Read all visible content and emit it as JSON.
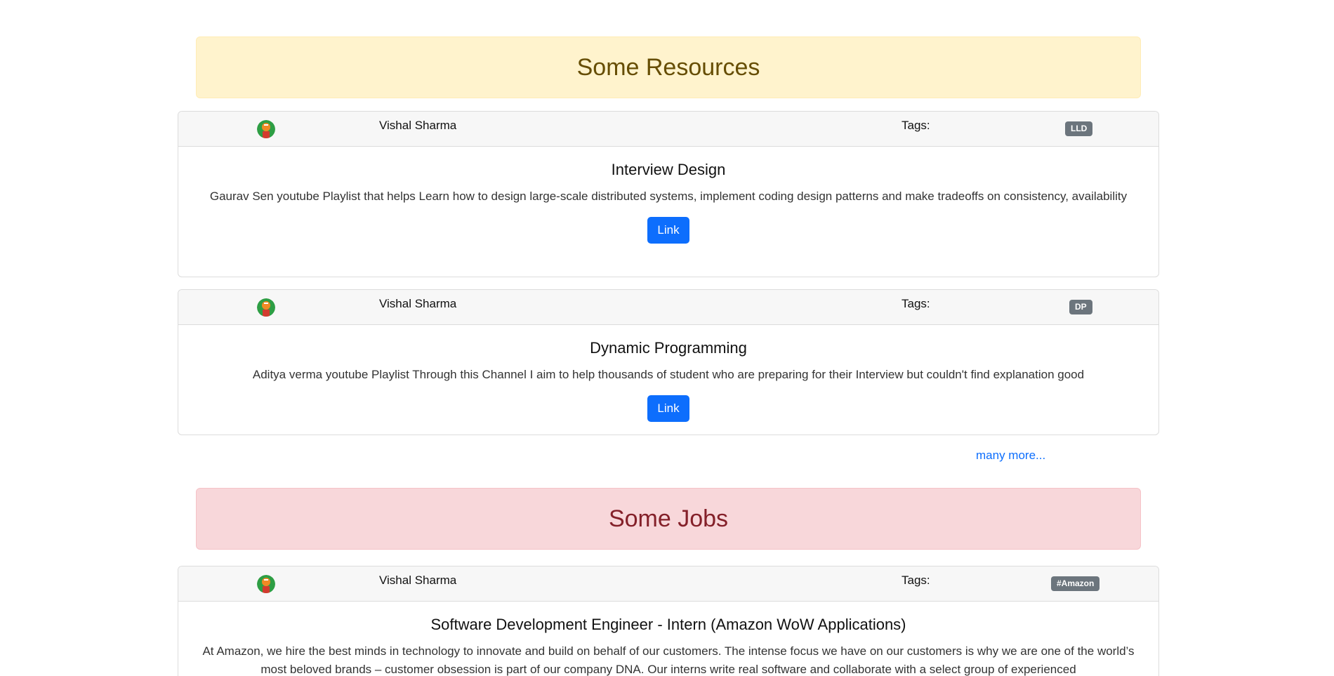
{
  "resources": {
    "heading": "Some Resources",
    "items": [
      {
        "author": "Vishal Sharma",
        "tags_label": "Tags:",
        "tag": "LLD",
        "title": "Interview Design",
        "description": "Gaurav Sen youtube Playlist that helps Learn how to design large-scale distributed systems, implement coding design patterns and make tradeoffs on consistency, availability",
        "button_label": "Link"
      },
      {
        "author": "Vishal Sharma",
        "tags_label": "Tags:",
        "tag": "DP",
        "title": "Dynamic Programming",
        "description": "Aditya verma youtube Playlist Through this Channel I aim to help thousands of student who are preparing for their Interview but couldn't find explanation good",
        "button_label": "Link"
      }
    ],
    "more_label": "many more..."
  },
  "jobs": {
    "heading": "Some Jobs",
    "items": [
      {
        "author": "Vishal Sharma",
        "tags_label": "Tags:",
        "tag": "#Amazon",
        "title": "Software Development Engineer - Intern (Amazon WoW Applications)",
        "description": "At Amazon, we hire the best minds in technology to innovate and build on behalf of our customers. The intense focus we have on our customers is why we are one of the world’s most beloved brands – customer obsession is part of our company DNA. Our interns write real software and collaborate with a select group of experienced"
      }
    ]
  },
  "colors": {
    "warning_bg": "#fff3cd",
    "danger_bg": "#f8d7da",
    "primary": "#0d6efd",
    "badge": "#6c757d"
  },
  "icons": {
    "avatar": "user-avatar-icon"
  }
}
